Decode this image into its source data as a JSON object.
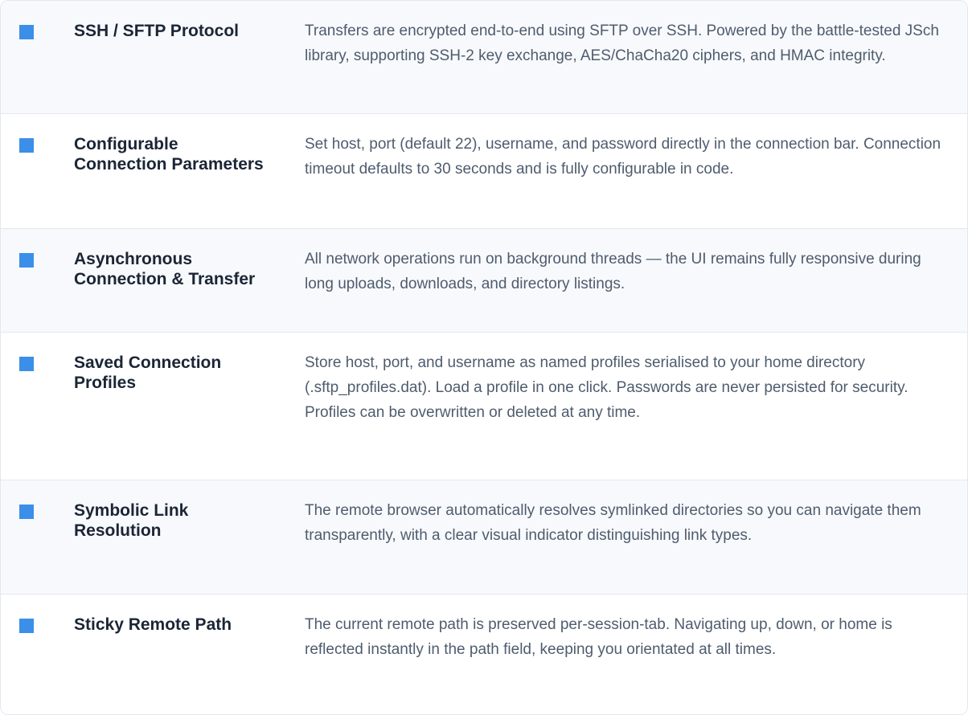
{
  "features": [
    {
      "title": "SSH / SFTP Protocol",
      "description": "Transfers are encrypted end-to-end using SFTP over SSH. Powered by the battle-tested JSch library, supporting SSH-2 key exchange, AES/ChaCha20 ciphers, and HMAC integrity."
    },
    {
      "title": "Configurable Connection Parameters",
      "description": "Set host, port (default 22), username, and password directly in the connection bar. Connection timeout defaults to 30 seconds and is fully configurable in code."
    },
    {
      "title": "Asynchronous Connection & Transfer",
      "description": "All network operations run on background threads — the UI remains fully responsive during long uploads, downloads, and directory listings."
    },
    {
      "title": "Saved Connection Profiles",
      "description": "Store host, port, and username as named profiles serialised to your home directory (.sftp_profiles.dat). Load a profile in one click. Passwords are never persisted for security. Profiles can be overwritten or deleted at any time."
    },
    {
      "title": "Symbolic Link Resolution",
      "description": "The remote browser automatically resolves symlinked directories so you can navigate them transparently, with a clear visual indicator distinguishing link types."
    },
    {
      "title": "Sticky Remote Path",
      "description": "The current remote path is preserved per-session-tab. Navigating up, down, or home is reflected instantly in the path field, keeping you orientated at all times."
    }
  ],
  "colors": {
    "bullet": "#3b8fe8",
    "title_text": "#1b2535",
    "description_text": "#4f5c6e"
  }
}
